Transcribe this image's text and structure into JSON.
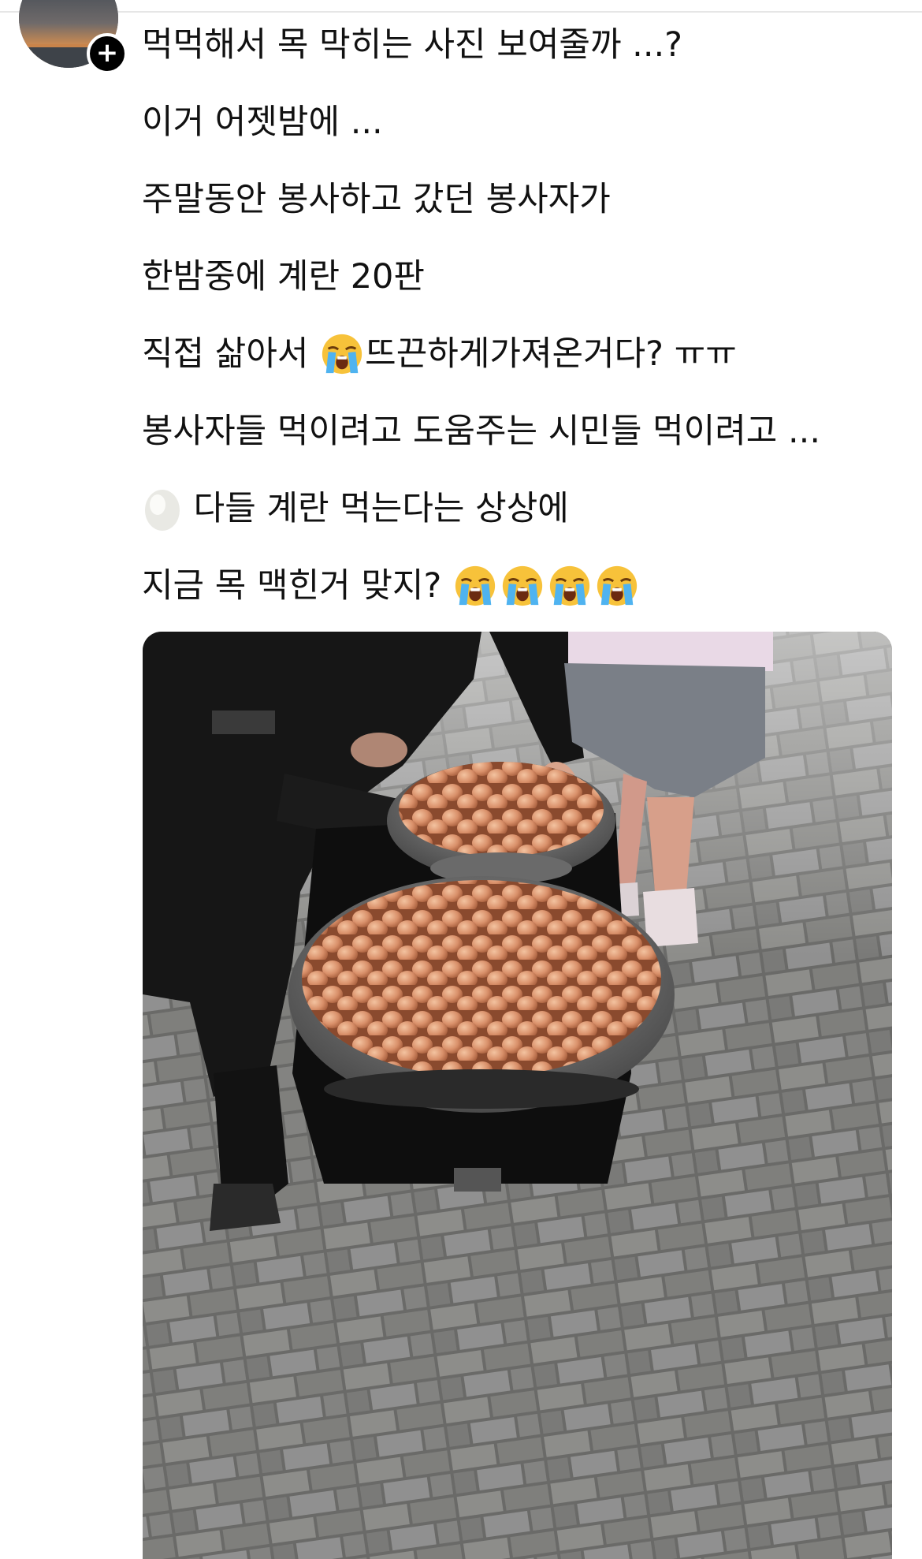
{
  "post": {
    "follow_label": "+",
    "lines": [
      {
        "text": "먹먹해서 목 막히는 사진 보여줄까 ...?"
      },
      {
        "text": "이거 어젯밤에 ..."
      },
      {
        "text": "주말동안 봉사하고 갔던 봉사자가"
      },
      {
        "text": "한밤중에 계란 20판"
      },
      {
        "before": "직접 삶아서 ",
        "emoji": "loudly-crying-face-emoji",
        "after": "뜨끈하게가져온거다? ㅠㅠ"
      },
      {
        "text": "봉사자들 먹이려고 도움주는 시민들 먹이려고 ..."
      },
      {
        "emoji": "egg-emoji",
        "after": " 다들 계란 먹는다는 상상에"
      },
      {
        "before": "지금 목  맥힌거 맞지? ",
        "emojis": [
          "loudly-crying-face-emoji",
          "loudly-crying-face-emoji",
          "loudly-crying-face-emoji",
          "loudly-crying-face-emoji"
        ]
      }
    ]
  },
  "colors": {
    "text": "#111111",
    "divider": "#e6e6e6",
    "follow_button": "#000000"
  },
  "media": {
    "type": "photo",
    "subject": "boiled eggs in metal basins on a cart over brick pavement"
  }
}
